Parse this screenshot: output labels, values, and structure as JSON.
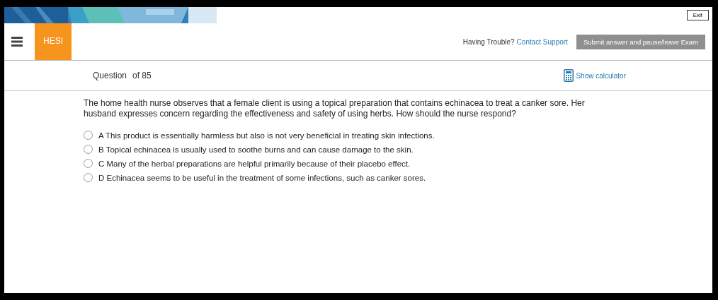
{
  "exit_button": "Exit",
  "header": {
    "logo": "HESI",
    "help_text": "Having Trouble?",
    "support_link": "Contact Support",
    "submit_button": {
      "label": "Submit answer and pause/leave Exam",
      "disabled": true
    }
  },
  "question_bar": {
    "label": "Question",
    "count": "of 85",
    "calculator_link": "Show calculator"
  },
  "question": "The home health nurse observes that a female client is using a topical preparation that contains echinacea to treat a canker sore. Her husband expresses concern regarding the effectiveness and safety of using herbs. How should the nurse respond?",
  "options": [
    {
      "letter": "A",
      "text": "This product is essentially harmless but also is not very beneficial in treating skin infections.",
      "selected": false
    },
    {
      "letter": "B",
      "text": "Topical echinacea is usually used to soothe burns and can cause damage to the skin.",
      "selected": false
    },
    {
      "letter": "C",
      "text": "Many of the herbal preparations are helpful primarily because of their placebo effect.",
      "selected": false
    },
    {
      "letter": "D",
      "text": "Echinacea seems to be useful in the treatment of some infections, such as canker sores.",
      "selected": false
    }
  ]
}
